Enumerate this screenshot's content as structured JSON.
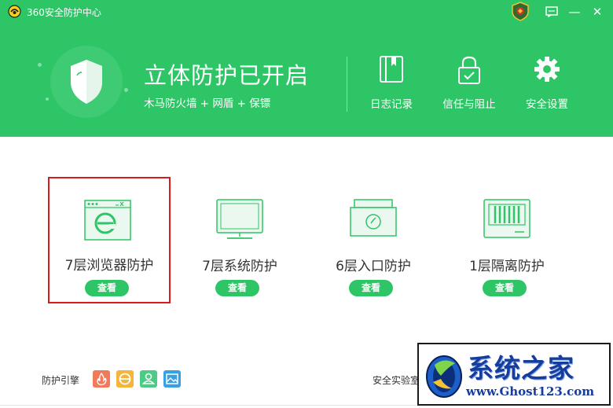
{
  "window": {
    "title": "360安全防护中心",
    "controls": {
      "feedback_icon": "message-icon",
      "minimize": "—",
      "close": "✕"
    }
  },
  "hero": {
    "title": "立体防护已开启",
    "subtitle": "木马防火墙 + 网盾 + 保镖"
  },
  "header_actions": [
    {
      "label": "日志记录",
      "icon": "log-book-icon"
    },
    {
      "label": "信任与阻止",
      "icon": "lock-icon"
    },
    {
      "label": "安全设置",
      "icon": "gear-icon"
    }
  ],
  "cards": [
    {
      "name": "7层浏览器防护",
      "button": "查看",
      "icon": "browser-icon",
      "selected": true
    },
    {
      "name": "7层系统防护",
      "button": "查看",
      "icon": "monitor-icon",
      "selected": false
    },
    {
      "name": "6层入口防护",
      "button": "查看",
      "icon": "entrance-icon",
      "selected": false
    },
    {
      "name": "1层隔离防护",
      "button": "查看",
      "icon": "isolation-icon",
      "selected": false
    }
  ],
  "footer": {
    "engine_label": "防护引擎",
    "engines": [
      {
        "icon": "fire-engine-icon",
        "color": "#f07a5a"
      },
      {
        "icon": "e-engine-icon",
        "color": "#f4b53a"
      },
      {
        "icon": "user-engine-icon",
        "color": "#4ccb85"
      },
      {
        "icon": "image-engine-icon",
        "color": "#3aa0e4"
      }
    ],
    "lab_text": "安全实验室"
  },
  "watermark": {
    "title": "系统之家",
    "url": "www.Ghost123.com"
  },
  "colors": {
    "brand_green": "#2dc565",
    "selected_border": "#d91a1a"
  }
}
